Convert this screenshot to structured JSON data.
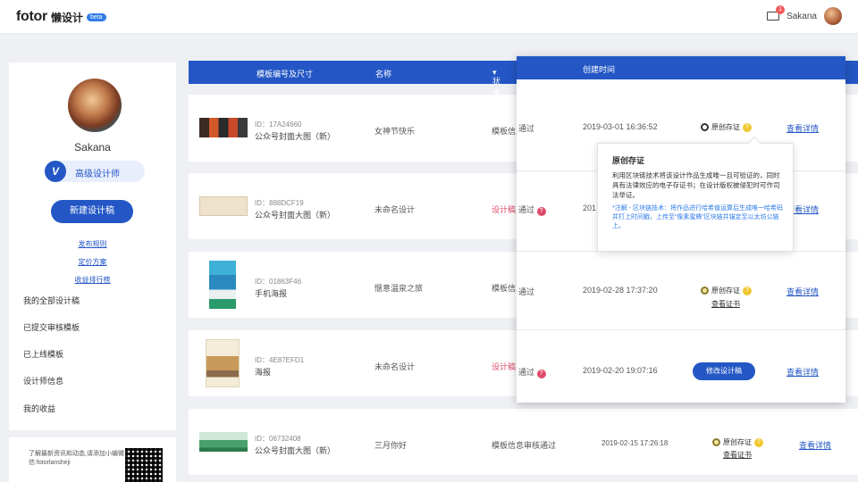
{
  "header": {
    "logo_main": "fotor",
    "logo_sub": "懒设计",
    "beta": "beta",
    "mail_count": "1",
    "username": "Sakana"
  },
  "sidebar": {
    "name": "Sakana",
    "level_icon": "V",
    "level": "高级设计师",
    "new_button": "新建设计稿",
    "links": [
      "发布规则",
      "定价方案",
      "收益排行榜"
    ],
    "menu": [
      "我的全部设计稿",
      "已提交审核模板",
      "已上线模板",
      "设计师信息",
      "我的收益"
    ],
    "promo": "了解最新资讯和动态,请添加小编微信:fotorlansheji"
  },
  "table": {
    "headers": [
      "模板编号及尺寸",
      "名称",
      "状态"
    ],
    "rows": [
      {
        "id": "ID：17A24660",
        "type": "公众号封面大图（新）",
        "name": "女神节快乐",
        "status": "模板信息"
      },
      {
        "id": "ID：888DCF19",
        "type": "公众号封面大图（新）",
        "name": "未命名设计",
        "status": "设计稿"
      },
      {
        "id": "ID：01863F46",
        "type": "手机海报",
        "name": "惬意温泉之旅",
        "status": "模板信息"
      },
      {
        "id": "ID：4E87EFD1",
        "type": "海报",
        "name": "未命名设计",
        "status": "设计稿"
      },
      {
        "id": "ID：06732408",
        "type": "公众号封面大图（新）",
        "name": "三月你好",
        "status": "模板信息审核通过",
        "date": "2019-02-15 17:26:18",
        "cert": "原创存证",
        "cert_link": "查看证书",
        "detail": "查看详情"
      }
    ]
  },
  "panel": {
    "header": "创建时间",
    "rows": [
      {
        "status": "通过",
        "date": "2019-03-01 16:36:52",
        "cert": "原创存证",
        "detail": "查看详情"
      },
      {
        "status": "通过",
        "date": "201",
        "detail": "查看详情"
      },
      {
        "status": "通过",
        "date": "2019-02-28 17:37:20",
        "cert": "原创存证",
        "cert_link": "查看证书",
        "detail": "查看详情"
      },
      {
        "status": "通过",
        "date": "2019-02-20 19:07:16",
        "edit_button": "修改设计稿",
        "detail": "查看详情"
      }
    ]
  },
  "tooltip": {
    "title": "原创存证",
    "body": "利用区块链技术将该设计作品生成唯一且可验证的，同时具有法律效应的电子存证书；在设计版权被侵犯时可作司法举证。",
    "note": "*注解 - 区块链技术：将作品进行哈希值运算后生成唯一哈希码并打上时间戳，上传至“像素蜜蜂”区块链并锚定至以太坊公链上。"
  },
  "colors": {
    "accent": "#2457c5",
    "status_red": "#e04a6a",
    "help_yellow": "#f0c830"
  }
}
